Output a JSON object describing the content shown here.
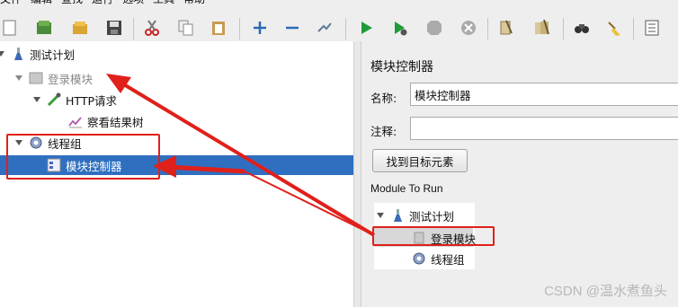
{
  "menu": [
    "文件",
    "编辑",
    "查找",
    "运行",
    "选项",
    "工具",
    "帮助"
  ],
  "toolbar_icons": [
    "new-icon",
    "templates-icon",
    "open-icon",
    "save-icon",
    "cut-icon",
    "copy-icon",
    "paste-icon",
    "expand-icon",
    "collapse-icon",
    "toggle-icon",
    "start-icon",
    "start-no-pause-icon",
    "stop-icon",
    "shutdown-icon",
    "clear-icon",
    "clear-all-icon",
    "search-icon",
    "reset-search-icon",
    "function-helper-icon"
  ],
  "tree": {
    "test_plan": "测试计划",
    "login_module": "登录模块",
    "http_request": "HTTP请求",
    "result_tree": "察看结果树",
    "thread_group": "线程组",
    "module_controller": "模块控制器"
  },
  "panel": {
    "title": "模块控制器",
    "name_label": "名称:",
    "name_value": "模块控制器",
    "comment_label": "注释:",
    "comment_value": "",
    "find_button": "找到目标元素",
    "module_to_run": "Module To Run"
  },
  "subtree": {
    "test_plan": "测试计划",
    "login_module": "登录模块",
    "thread_group": "线程组"
  },
  "watermark": "CSDN @温水煮鱼头",
  "colors": {
    "selection": "#2f6fc0",
    "annotation": "#e0201b",
    "run_green": "#1e9c3a"
  }
}
